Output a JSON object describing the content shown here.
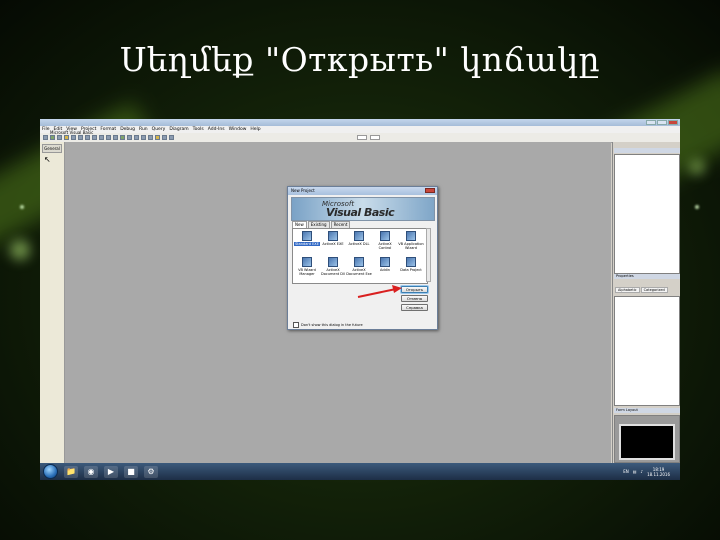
{
  "slide": {
    "title": "Սեղմեք \"Открыть\" կոճակը"
  },
  "ide": {
    "window_title": "Microsoft Visual Basic",
    "menu": [
      "File",
      "Edit",
      "View",
      "Project",
      "Format",
      "Debug",
      "Run",
      "Query",
      "Diagram",
      "Tools",
      "Add-Ins",
      "Window",
      "Help"
    ],
    "toolbox_header": "General",
    "panels": {
      "project_header": "",
      "properties_header": "Properties",
      "properties_tabs": [
        "Alphabetic",
        "Categorized"
      ],
      "form_layout_header": "Form Layout"
    },
    "taskbar": {
      "lang": "EN",
      "time": "18:19",
      "date": "18.11.2016"
    }
  },
  "dialog": {
    "title": "New Project",
    "banner_top": "Microsoft",
    "banner_main": "Visual Basic",
    "tabs": [
      "New",
      "Existing",
      "Recent"
    ],
    "projects": [
      {
        "label": "Standard EXE"
      },
      {
        "label": "ActiveX EXE"
      },
      {
        "label": "ActiveX DLL"
      },
      {
        "label": "ActiveX Control"
      },
      {
        "label": "VB Application Wizard"
      },
      {
        "label": "VB Wizard Manager"
      },
      {
        "label": "ActiveX Document Dll"
      },
      {
        "label": "ActiveX Document Exe"
      },
      {
        "label": "Addin"
      },
      {
        "label": "Data Project"
      }
    ],
    "buttons": {
      "open": "Открыть",
      "cancel": "Отмена",
      "help": "Справка"
    },
    "checkbox_label": "Don't show this dialog in the future"
  },
  "colors": {
    "annotation_arrow": "#d92020",
    "selection": "#3169c6"
  }
}
